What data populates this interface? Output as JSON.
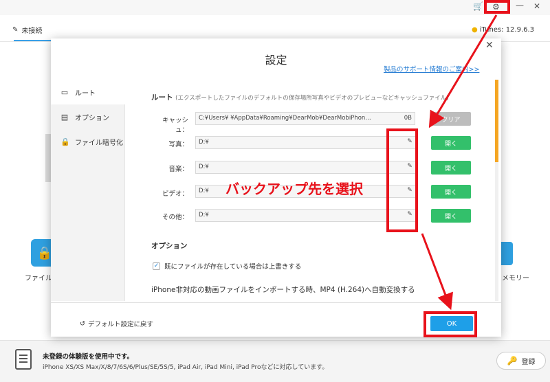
{
  "app": {
    "device_tab_label": "未接続",
    "itunes_version": "iTunes: 12.9.6.3",
    "bg_file_label": "ファイル",
    "bg_memory_label": "メモリー"
  },
  "modal": {
    "title": "設定",
    "support_link": "製品のサポート情報のご案内>>",
    "sidebar_items": [
      {
        "label": "ルート",
        "icon": "folder-icon"
      },
      {
        "label": "オプション",
        "icon": "options-icon"
      },
      {
        "label": "ファイル暗号化",
        "icon": "lock-icon"
      }
    ],
    "route_section": {
      "title": "ルート",
      "note": "(エクスポートしたファイルのデフォルトの保存場所写真やビデオのプレビューなどキャッシュファイル)",
      "cache": {
        "label": "キャッシュ：",
        "value": "C:¥Users¥          ¥AppData¥Roaming¥DearMob¥DearMobiPhon…",
        "size": "0B",
        "clear_label": "クリア"
      },
      "rows": [
        {
          "label": "写真：",
          "value": "D:¥",
          "open_label": "開く"
        },
        {
          "label": "音楽：",
          "value": "D:¥",
          "open_label": "開く"
        },
        {
          "label": "ビデオ：",
          "value": "D:¥",
          "open_label": "開く"
        },
        {
          "label": "その他：",
          "value": "D:¥",
          "open_label": "開く"
        }
      ]
    },
    "options_section": {
      "title": "オプション",
      "overwrite_checkbox_label": "既にファイルが存在している場合は上書きする",
      "overwrite_checked": true,
      "convert_text": "iPhone非対応の動画ファイルをインポートする時、MP4 (H.264)へ自動変換する"
    },
    "reset_label": "デフォルト設定に戻す",
    "ok_label": "OK"
  },
  "annotation": {
    "callout_text": "バックアップ先を選択",
    "color": "#e8121b"
  },
  "footer": {
    "trial_title": "未登録の体験版を使用中です。",
    "trial_models": "iPhone XS/XS Max/X/8/7/6S/6/Plus/SE/5S/5, iPad Air, iPad Mini, iPad Proなどに対応しています。",
    "register_label": "登録"
  }
}
